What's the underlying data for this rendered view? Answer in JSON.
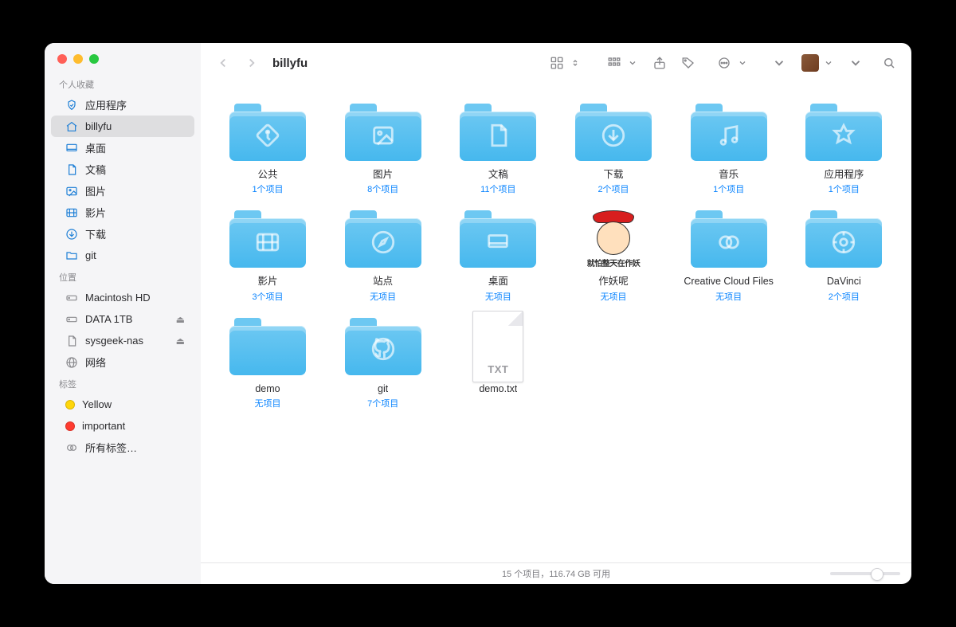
{
  "window_title": "billyfu",
  "sidebar": {
    "sections": [
      {
        "title": "个人收藏",
        "items": [
          {
            "icon": "app",
            "label": "应用程序"
          },
          {
            "icon": "home",
            "label": "billyfu",
            "selected": true
          },
          {
            "icon": "desktop",
            "label": "桌面"
          },
          {
            "icon": "doc",
            "label": "文稿"
          },
          {
            "icon": "image",
            "label": "图片"
          },
          {
            "icon": "film",
            "label": "影片"
          },
          {
            "icon": "download",
            "label": "下载"
          },
          {
            "icon": "folder",
            "label": "git"
          }
        ]
      },
      {
        "title": "位置",
        "items": [
          {
            "icon": "hdd",
            "label": "Macintosh HD",
            "gray": true
          },
          {
            "icon": "hdd",
            "label": "DATA 1TB",
            "gray": true,
            "eject": true
          },
          {
            "icon": "doc",
            "label": "sysgeek-nas",
            "gray": true,
            "eject": true
          },
          {
            "icon": "globe",
            "label": "网络",
            "gray": true
          }
        ]
      },
      {
        "title": "标签",
        "items": [
          {
            "tag": "yellow",
            "label": "Yellow"
          },
          {
            "tag": "red",
            "label": "important"
          },
          {
            "icon": "alltags",
            "label": "所有标签…",
            "gray": true
          }
        ]
      }
    ]
  },
  "toolbar": {
    "view_dropdown": "icon-grid",
    "group_dropdown": "group",
    "share": "share",
    "tag": "tag",
    "action": "action",
    "search": "search"
  },
  "items": [
    {
      "type": "folder",
      "glyph": "public",
      "name": "公共",
      "meta": "1个项目"
    },
    {
      "type": "folder",
      "glyph": "image",
      "name": "图片",
      "meta": "8个项目"
    },
    {
      "type": "folder",
      "glyph": "doc",
      "name": "文稿",
      "meta": "11个项目"
    },
    {
      "type": "folder",
      "glyph": "download",
      "name": "下载",
      "meta": "2个项目"
    },
    {
      "type": "folder",
      "glyph": "music",
      "name": "音乐",
      "meta": "1个项目"
    },
    {
      "type": "folder",
      "glyph": "app",
      "name": "应用程序",
      "meta": "1个项目"
    },
    {
      "type": "folder",
      "glyph": "film",
      "name": "影片",
      "meta": "3个项目"
    },
    {
      "type": "folder",
      "glyph": "compass",
      "name": "站点",
      "meta": "无项目"
    },
    {
      "type": "folder",
      "glyph": "desktop",
      "name": "桌面",
      "meta": "无项目"
    },
    {
      "type": "image",
      "name": "作妖呢",
      "meta": "无项目",
      "caption": "就怕整天在作妖"
    },
    {
      "type": "folder",
      "glyph": "ccloud",
      "name": "Creative Cloud Files",
      "meta": "无项目"
    },
    {
      "type": "folder",
      "glyph": "davinci",
      "name": "DaVinci",
      "meta": "2个项目"
    },
    {
      "type": "folder",
      "glyph": "plain",
      "name": "demo",
      "meta": "无项目"
    },
    {
      "type": "folder",
      "glyph": "github",
      "name": "git",
      "meta": "7个项目"
    },
    {
      "type": "file",
      "ext": "TXT",
      "name": "demo.txt"
    }
  ],
  "statusbar": {
    "text": "15 个项目，116.74 GB 可用"
  }
}
